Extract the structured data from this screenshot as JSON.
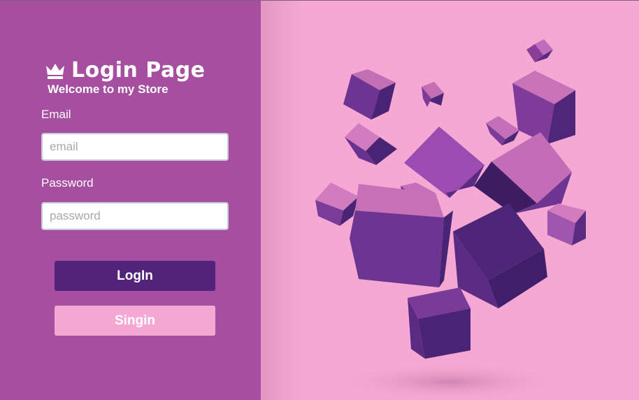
{
  "login_panel": {
    "title": "Login Page",
    "subtitle": "Welcome to my Store",
    "email_label": "Email",
    "email_placeholder": "email",
    "email_value": "",
    "password_label": "Password",
    "password_placeholder": "password",
    "password_value": "",
    "login_button_label": "LogIn",
    "signin_button_label": "Singin"
  },
  "icons": {
    "title_icon": "crown-icon"
  },
  "colors": {
    "panel_background": "#a64fa0",
    "art_background": "#f6a8d4",
    "login_button": "#51247a",
    "signin_button": "#f6a8d4",
    "text": "#ffffff"
  }
}
